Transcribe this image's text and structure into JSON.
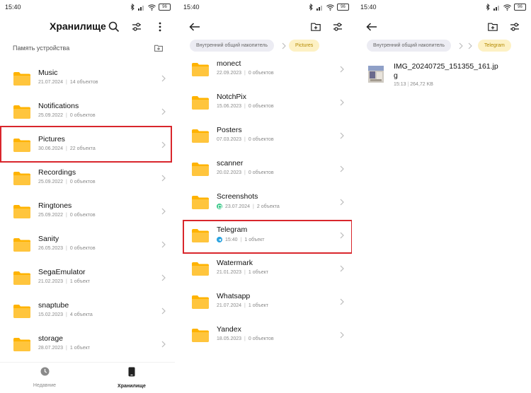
{
  "colors": {
    "accent": "#FFB300",
    "highlight": "#D9262C",
    "chip_yellow": "#FDF1C4",
    "chip_grey": "#ECECF3"
  },
  "status_time": "15:40",
  "battery": "96",
  "screen1": {
    "title": "Хранилище",
    "storage_label": "Память устройства",
    "items": [
      {
        "name": "Music",
        "date": "21.07.2024",
        "count": "14 объектов"
      },
      {
        "name": "Notifications",
        "date": "25.09.2022",
        "count": "0 объектов"
      },
      {
        "name": "Pictures",
        "date": "30.06.2024",
        "count": "22 объекта"
      },
      {
        "name": "Recordings",
        "date": "25.09.2022",
        "count": "0 объектов"
      },
      {
        "name": "Ringtones",
        "date": "25.09.2022",
        "count": "0 объектов"
      },
      {
        "name": "Sanity",
        "date": "26.05.2023",
        "count": "0 объектов"
      },
      {
        "name": "SegaEmulator",
        "date": "21.02.2023",
        "count": "1 объект"
      },
      {
        "name": "snaptube",
        "date": "15.02.2023",
        "count": "4 объекта"
      },
      {
        "name": "storage",
        "date": "28.07.2023",
        "count": "1 объект"
      }
    ],
    "nav": {
      "recent": "Недавние",
      "storage": "Хранилище"
    }
  },
  "screen2": {
    "breadcrumbs": [
      "Внутренний общий накопитель",
      "Pictures"
    ],
    "items": [
      {
        "name": "monect",
        "date": "22.09.2023",
        "count": "0 объектов"
      },
      {
        "name": "NotchPix",
        "date": "15.06.2023",
        "count": "0 объектов"
      },
      {
        "name": "Posters",
        "date": "07.03.2023",
        "count": "0 объектов"
      },
      {
        "name": "scanner",
        "date": "20.02.2023",
        "count": "0 объектов"
      },
      {
        "name": "Screenshots",
        "date": "23.07.2024",
        "count": "2 объекта"
      },
      {
        "name": "Telegram",
        "date": "15:40",
        "count": "1 объект"
      },
      {
        "name": "Watermark",
        "date": "21.01.2023",
        "count": "1 объект"
      },
      {
        "name": "Whatsapp",
        "date": "21.07.2024",
        "count": "1 объект"
      },
      {
        "name": "Yandex",
        "date": "18.05.2023",
        "count": "0 объектов"
      }
    ]
  },
  "screen3": {
    "breadcrumbs": [
      "Внутренний общий накопитель",
      "Telegram"
    ],
    "file": {
      "name": "IMG_20240725_151355_161.jpg",
      "time": "15:13",
      "size": "264,72 KB"
    }
  },
  "meta_separator": "|",
  "icons": [
    "back-arrow-icon",
    "search-icon",
    "filter-icon",
    "more-vert-icon",
    "new-folder-icon",
    "folder-icon",
    "chevron-right-icon",
    "clock-icon",
    "phone-icon",
    "screenshot-badge-icon",
    "telegram-badge-icon",
    "wifi-icon",
    "signal-icon",
    "bluetooth-icon"
  ]
}
